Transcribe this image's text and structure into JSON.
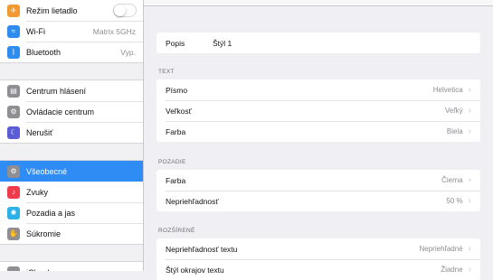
{
  "sidebar": {
    "group1": [
      {
        "label": "Režim lietadlo",
        "icon": "airplane-icon",
        "color": "#f29a2e",
        "glyph": "✈",
        "toggle": false
      },
      {
        "label": "Wi-Fi",
        "icon": "wifi-icon",
        "color": "#2d8cf0",
        "glyph": "≈",
        "value": "Matrix 5GHz"
      },
      {
        "label": "Bluetooth",
        "icon": "bluetooth-icon",
        "color": "#2d8cf0",
        "glyph": "ᛒ",
        "value": "Vyp."
      }
    ],
    "group2": [
      {
        "label": "Centrum hlásení",
        "icon": "notification-center-icon",
        "color": "#8e8e93",
        "glyph": "▤"
      },
      {
        "label": "Ovládacie centrum",
        "icon": "control-center-icon",
        "color": "#8e8e93",
        "glyph": "⚙"
      },
      {
        "label": "Nerušiť",
        "icon": "do-not-disturb-icon",
        "color": "#5b5bd6",
        "glyph": "☾"
      }
    ],
    "group3": [
      {
        "label": "Všeobecné",
        "icon": "general-gear-icon",
        "color": "#8e8e93",
        "glyph": "⚙",
        "selected": true
      },
      {
        "label": "Zvuky",
        "icon": "sounds-icon",
        "color": "#ee3a4b",
        "glyph": "♪"
      },
      {
        "label": "Pozadia a jas",
        "icon": "wallpaper-brightness-icon",
        "color": "#2bb1e8",
        "glyph": "✺"
      },
      {
        "label": "Súkromie",
        "icon": "privacy-hand-icon",
        "color": "#8e8e93",
        "glyph": "✋"
      }
    ],
    "group4": [
      {
        "label": "iCloud",
        "icon": "icloud-icon",
        "color": "#8e8e93",
        "glyph": "☁"
      }
    ]
  },
  "main": {
    "style_row": {
      "label": "Popis",
      "value": "Štýl 1"
    },
    "sections": [
      {
        "header": "TEXT",
        "rows": [
          {
            "label": "Písmo",
            "value": "Helvetica"
          },
          {
            "label": "Veľkosť",
            "value": "Veľký"
          },
          {
            "label": "Farba",
            "value": "Biela"
          }
        ]
      },
      {
        "header": "POZADIE",
        "rows": [
          {
            "label": "Farba",
            "value": "Čierna"
          },
          {
            "label": "Nepriehľadnosť",
            "value": "50 %"
          }
        ]
      },
      {
        "header": "ROZŠÍRENÉ",
        "rows": [
          {
            "label": "Nepriehľadnosť textu",
            "value": "Nepriehľadné"
          },
          {
            "label": "Štýl okrajov textu",
            "value": "Žiadne"
          }
        ]
      }
    ]
  },
  "chevron": "›"
}
